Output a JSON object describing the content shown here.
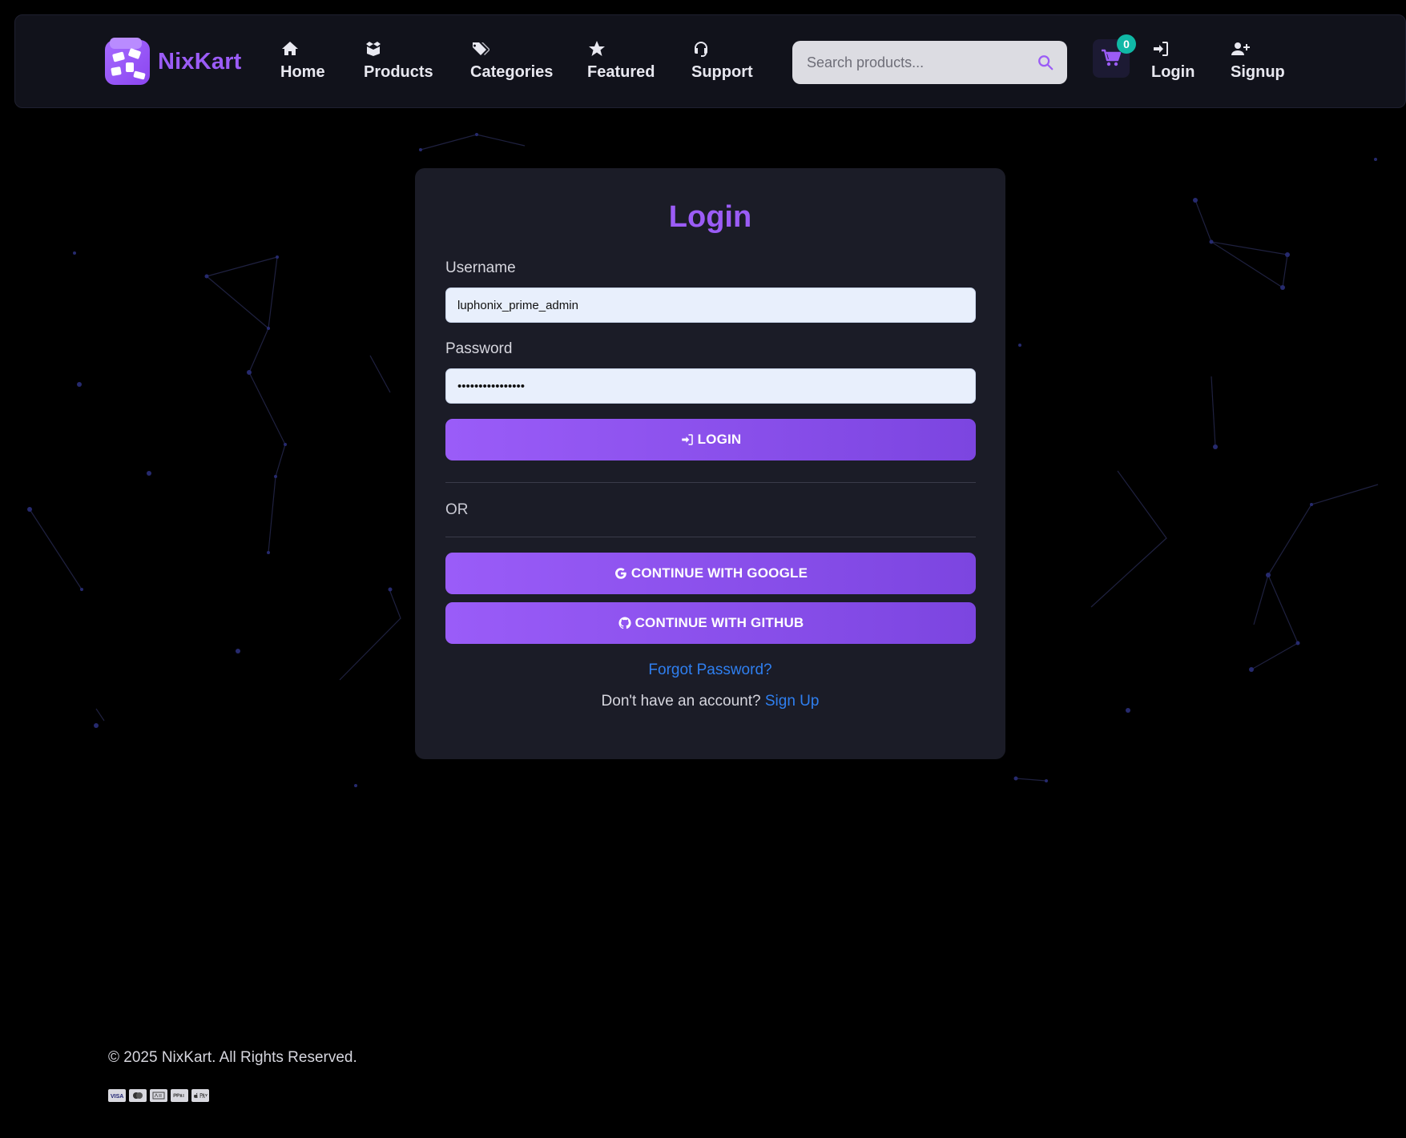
{
  "brand": {
    "name": "NixKart",
    "accent_color": "#9b5cf6"
  },
  "nav": {
    "items": [
      {
        "label": "Home",
        "icon": "home-icon"
      },
      {
        "label": "Products",
        "icon": "box-icon"
      },
      {
        "label": "Categories",
        "icon": "tags-icon"
      },
      {
        "label": "Featured",
        "icon": "star-icon"
      },
      {
        "label": "Support",
        "icon": "headset-icon"
      }
    ],
    "search": {
      "placeholder": "Search products...",
      "icon": "search-icon"
    },
    "cart": {
      "count": "0",
      "icon": "cart-icon",
      "badge_color": "#10b8a6"
    },
    "login": {
      "label": "Login",
      "icon": "sign-in-icon"
    },
    "signup": {
      "label": "Signup",
      "icon": "user-plus-icon"
    }
  },
  "login_card": {
    "title": "Login",
    "username_label": "Username",
    "username_value": "luphonix_prime_admin",
    "password_label": "Password",
    "password_value": "••••••••••••••••",
    "login_button": "LOGIN",
    "or_text": "OR",
    "google_button": "CONTINUE WITH GOOGLE",
    "github_button": "CONTINUE WITH GITHUB",
    "forgot_password": "Forgot Password?",
    "no_account_text": "Don't have an account?",
    "signup_link": "Sign Up",
    "link_color": "#2f7ff0"
  },
  "footer": {
    "copyright": "© 2025 NixKart. All Rights Reserved.",
    "payment_icons": [
      "visa-icon",
      "mastercard-icon",
      "amex-icon",
      "paypal-icon",
      "apple-pay-icon"
    ]
  }
}
